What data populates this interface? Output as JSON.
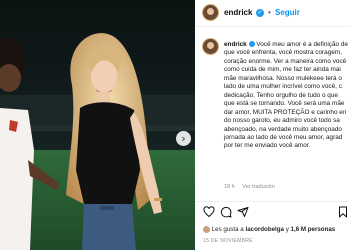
{
  "post": {
    "author": "endrick",
    "follow_label": "Seguir",
    "separator": "•",
    "caption_text": "Você meu amor é a definição de que você enfrenta, você mostra coragem, coração enorme. Ver a maneira como você como cuida de mim, me faz ter ainda mai mãe maravilhosa. Nosso mulekeee terá o lado de uma mulher incrível como você, c dedicação. Tenho orgulho de tudo o que que está se tornando. Você será uma mãe dar amor, MUITA PROTEÇÃO e carinho en do nosso garoto, eu admiro você todo sa abençoado, na verdade muito abençoado jornada ao lado de você meu amor, agrad por ter me enviado você amor.",
    "time_ago": "18 h",
    "translate_label": "Ver tradución",
    "likes_prefix": "Les gusta a",
    "likes_user": "lacordobelga",
    "likes_connector": "y",
    "likes_others": "1,6 M personas",
    "date": "15 DE NOVIEMBRE"
  },
  "icons": {
    "verified": "verified-badge-icon",
    "next": "chevron-right-icon",
    "like": "heart-icon",
    "comment": "comment-icon",
    "share": "share-icon",
    "save": "bookmark-icon"
  },
  "colors": {
    "follow": "#0095f6",
    "verified": "#1d9bf0",
    "meta": "#8e8e8e"
  }
}
